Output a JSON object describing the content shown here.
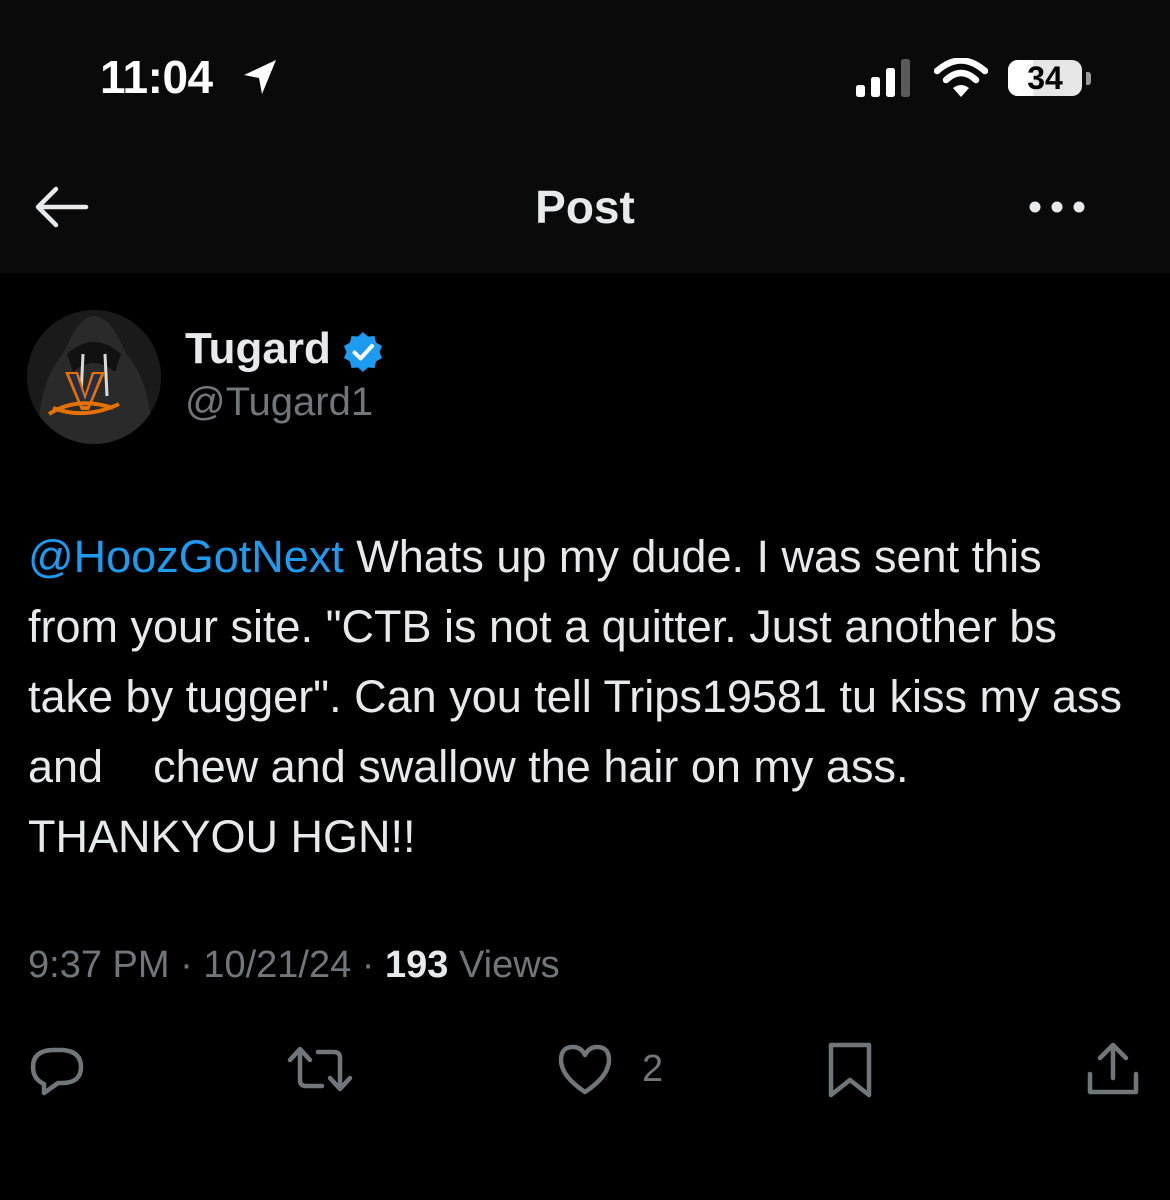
{
  "status_bar": {
    "time": "11:04",
    "battery": "34",
    "battery_level": 0.34
  },
  "nav": {
    "title": "Post"
  },
  "author": {
    "name": "Tugard",
    "handle": "@Tugard1",
    "verified": true
  },
  "post": {
    "mention": "@HoozGotNext",
    "text": " Whats up my dude. I was sent this from your site. \"CTB is not a quitter. Just another bs take by tugger\". Can you tell Trips19581 tu kiss my ass and    chew and swallow the hair on my ass. THANKYOU HGN!!"
  },
  "meta": {
    "time": "9:37 PM",
    "date": "10/21/24",
    "views_count": "193",
    "views_label": "Views"
  },
  "actions": {
    "like_count": "2"
  },
  "colors": {
    "accent": "#1d9bf0",
    "background": "#000000",
    "header_background": "#0a0a0a",
    "text": "#e7e9ea",
    "muted": "#71767b"
  }
}
